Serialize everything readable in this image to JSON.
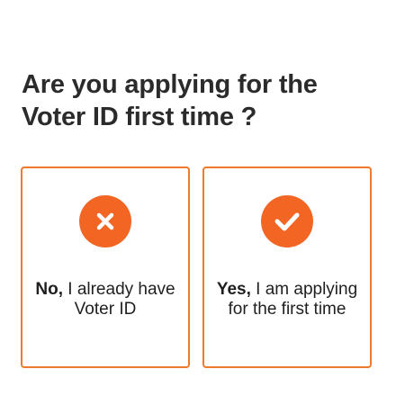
{
  "question": {
    "line1": "Are you applying for the",
    "line2": "Voter ID first time ?"
  },
  "options": [
    {
      "id": "no",
      "icon": "close-icon",
      "bold": "No,",
      "text_line1": " I already have",
      "text_line2": "Voter ID"
    },
    {
      "id": "yes",
      "icon": "checkmark-icon",
      "bold": "Yes,",
      "text_line1": " I am applying",
      "text_line2": "for the first time"
    }
  ],
  "colors": {
    "accent": "#f26522",
    "border": "#f07a2c",
    "text": "#2b2b2b"
  }
}
